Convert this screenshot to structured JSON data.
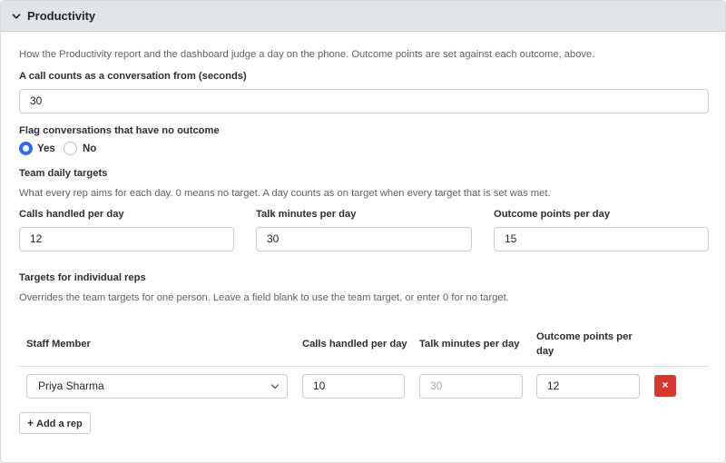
{
  "section": {
    "title": "Productivity",
    "description": "How the Productivity report and the dashboard judge a day on the phone. Outcome points are set against each outcome, above."
  },
  "conversation_threshold": {
    "label": "A call counts as a conversation from (seconds)",
    "value": "30"
  },
  "flag_no_outcome": {
    "label": "Flag conversations that have no outcome",
    "options": [
      {
        "label": "Yes",
        "selected": true
      },
      {
        "label": "No",
        "selected": false
      }
    ]
  },
  "team_targets": {
    "heading": "Team daily targets",
    "help": "What every rep aims for each day. 0 means no target. A day counts as on target when every target that is set was met.",
    "fields": [
      {
        "label": "Calls handled per day",
        "value": "12"
      },
      {
        "label": "Talk minutes per day",
        "value": "30"
      },
      {
        "label": "Outcome points per day",
        "value": "15"
      }
    ]
  },
  "rep_targets": {
    "heading": "Targets for individual reps",
    "help": "Overrides the team targets for one person. Leave a field blank to use the team target, or enter 0 for no target.",
    "columns": [
      "Staff Member",
      "Calls handled per day",
      "Talk minutes per day",
      "Outcome points per day"
    ],
    "rows": [
      {
        "staff_member": "Priya Sharma",
        "calls_handled": "10",
        "talk_minutes_placeholder": "30",
        "outcome_points": "12"
      }
    ],
    "delete_label": "×",
    "add_label": "Add a rep"
  },
  "colors": {
    "accent": "#2f6fe0",
    "danger": "#d7372f",
    "header_bg": "#e2e5e8"
  },
  "icons": {
    "collapse": "chevron-down-icon",
    "select": "chevron-down-icon",
    "add": "plus-icon",
    "delete": "close-icon"
  }
}
